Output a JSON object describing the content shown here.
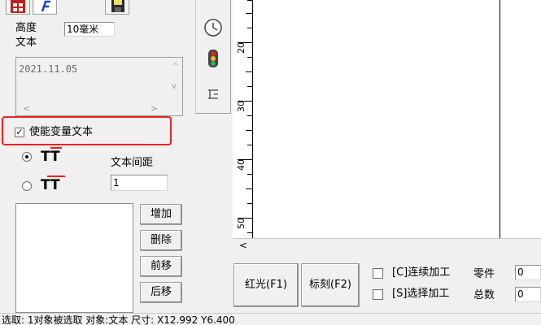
{
  "left_panel": {
    "height_label": "高度",
    "height_value": "10毫米",
    "text_label": "文本",
    "text_value": "2021.11.05",
    "variable_text_checkbox": "使能变量文本",
    "spacing_label": "文本间距",
    "spacing_value": "1",
    "tt_glyph": "TT",
    "buttons": {
      "add": "增加",
      "delete": "删除",
      "forward": "前移",
      "backward": "后移"
    }
  },
  "ruler_labels": [
    "20",
    "30",
    "40",
    "50"
  ],
  "bottom": {
    "red_light_button": "红光(F1)",
    "mark_button": "标刻(F2)",
    "continuous_label": "[C]连续加工",
    "select_label": "[S]选择加工",
    "parts_label": "零件",
    "parts_value": "0",
    "total_label": "总数",
    "total_value": "0"
  },
  "status_text": "选取: 1对象被选取 对象:文本 尺寸: X12.992 Y6.400",
  "colors": {
    "highlight_box": "#e8231f",
    "toolbar_icon_red": "#c0201c",
    "toolbar_icon_blue": "#1d3fc6"
  },
  "icons": [
    "grid-icon",
    "text-format-icon",
    "save-icon",
    "clock-icon",
    "traffic-light-icon",
    "text-tool-icon"
  ]
}
